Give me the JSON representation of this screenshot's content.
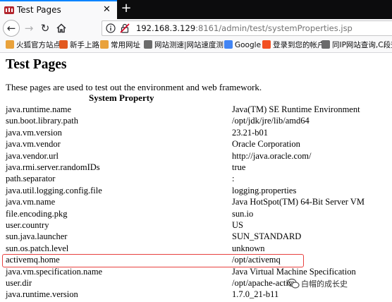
{
  "browser": {
    "tab_title": "Test Pages",
    "tab_close": "✕",
    "new_tab": "+",
    "url": {
      "host": "192.168.3.129",
      "rest": ":8161/admin/test/systemProperties.jsp"
    },
    "bookmarks": [
      {
        "label": "火狐官方站点",
        "color": "#e9a23b"
      },
      {
        "label": "新手上路",
        "color": "#e25920"
      },
      {
        "label": "常用网址",
        "color": "#e9a23b"
      },
      {
        "label": "网站测速|网站速度测...",
        "color": "#6b6b6b"
      },
      {
        "label": "Google",
        "color": "#4285f4"
      },
      {
        "label": "登录到您的帐户",
        "color": "#f25022"
      },
      {
        "label": "同IP网站查询,C段查询",
        "color": "#6b6b6b"
      }
    ]
  },
  "page": {
    "title": "Test Pages",
    "intro": "These pages are used to test out the environment and web framework.",
    "column_header": "System Property",
    "properties": [
      {
        "key": "java.runtime.name",
        "value": "Java(TM) SE Runtime Environment"
      },
      {
        "key": "sun.boot.library.path",
        "value": "/opt/jdk/jre/lib/amd64"
      },
      {
        "key": "java.vm.version",
        "value": "23.21-b01"
      },
      {
        "key": "java.vm.vendor",
        "value": "Oracle Corporation"
      },
      {
        "key": "java.vendor.url",
        "value": "http://java.oracle.com/"
      },
      {
        "key": "java.rmi.server.randomIDs",
        "value": "true"
      },
      {
        "key": "path.separator",
        "value": ":"
      },
      {
        "key": "java.util.logging.config.file",
        "value": "logging.properties"
      },
      {
        "key": "java.vm.name",
        "value": "Java HotSpot(TM) 64-Bit Server VM"
      },
      {
        "key": "file.encoding.pkg",
        "value": "sun.io"
      },
      {
        "key": "user.country",
        "value": "US"
      },
      {
        "key": "sun.java.launcher",
        "value": "SUN_STANDARD"
      },
      {
        "key": "sun.os.patch.level",
        "value": "unknown"
      },
      {
        "key": "activemq.home",
        "value": "/opt/activemq"
      },
      {
        "key": "java.vm.specification.name",
        "value": "Java Virtual Machine Specification"
      },
      {
        "key": "user.dir",
        "value": "/opt/apache-activ"
      },
      {
        "key": "java.runtime.version",
        "value": "1.7.0_21-b11"
      }
    ],
    "highlighted_key": "activemq.home"
  },
  "watermark": {
    "text": "白帽的成长史"
  },
  "colors": {
    "accent": "#0a84ff",
    "highlight": "#e8403f",
    "tabbar": "#0c0c0d"
  }
}
